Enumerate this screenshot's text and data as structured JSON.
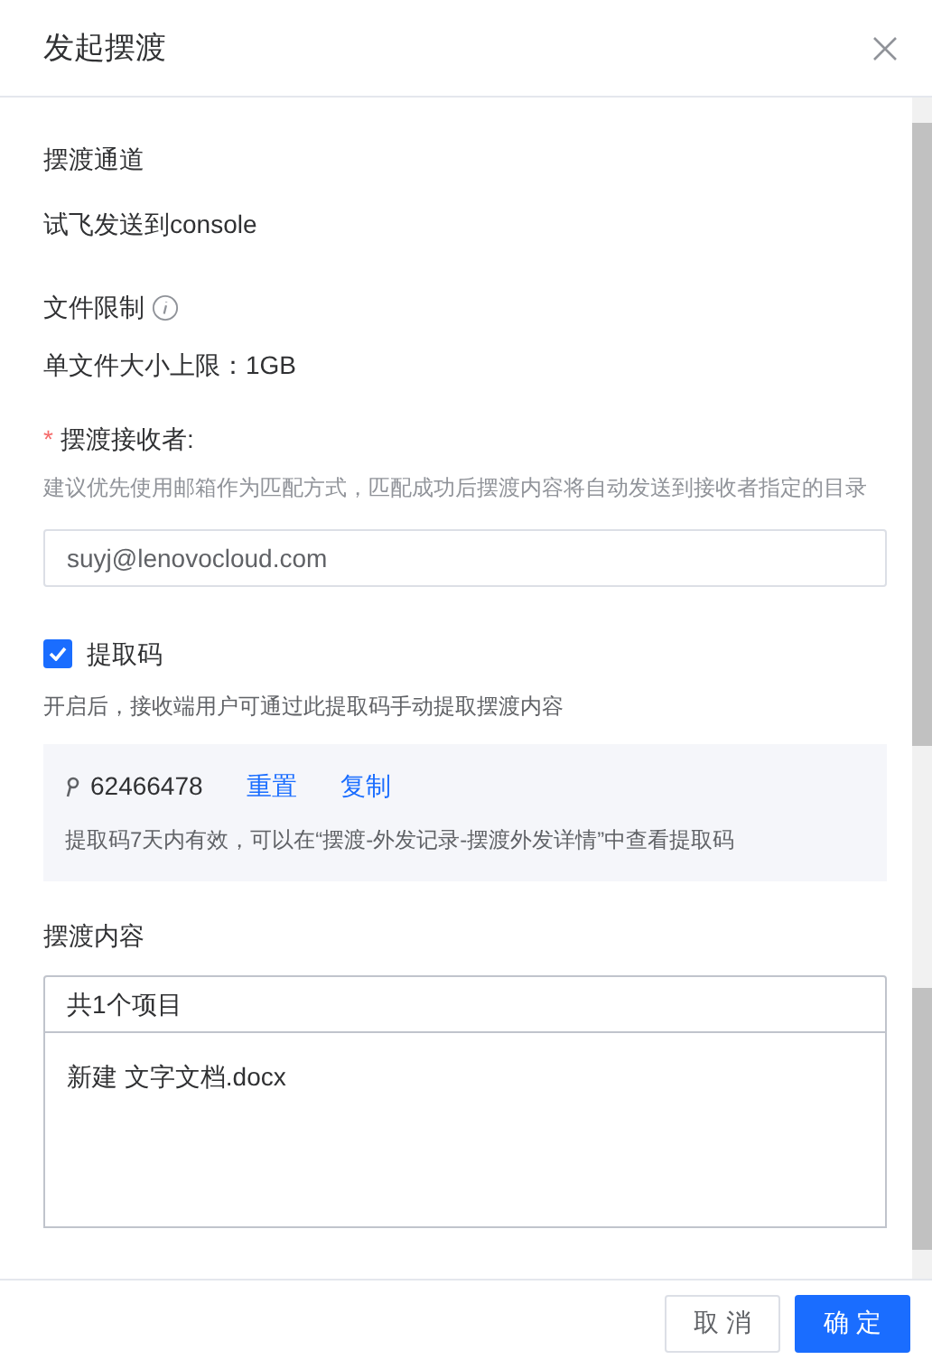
{
  "dialog": {
    "title": "发起摆渡"
  },
  "channel": {
    "label": "摆渡通道",
    "value": "试飞发送到console"
  },
  "file_limit": {
    "label": "文件限制",
    "value": "单文件大小上限：1GB"
  },
  "recipient": {
    "label": "摆渡接收者:",
    "required_mark": "*",
    "hint": "建议优先使用邮箱作为匹配方式，匹配成功后摆渡内容将自动发送到接收者指定的目录",
    "value": "suyj@lenovocloud.com"
  },
  "extraction_code": {
    "label": "提取码",
    "checked": true,
    "hint": "开启后，接收端用户可通过此提取码手动提取摆渡内容",
    "code": "62466478",
    "links": [
      "重置",
      "复制"
    ],
    "note": "提取码7天内有效，可以在“摆渡-外发记录-摆渡外发详情”中查看提取码"
  },
  "content": {
    "label": "摆渡内容",
    "summary": "共1个项目",
    "items": [
      "新建 文字文档.docx"
    ]
  },
  "buttons": [
    {
      "label": "取 消",
      "kind": "secondary"
    },
    {
      "label": "确 定",
      "kind": "primary"
    }
  ]
}
